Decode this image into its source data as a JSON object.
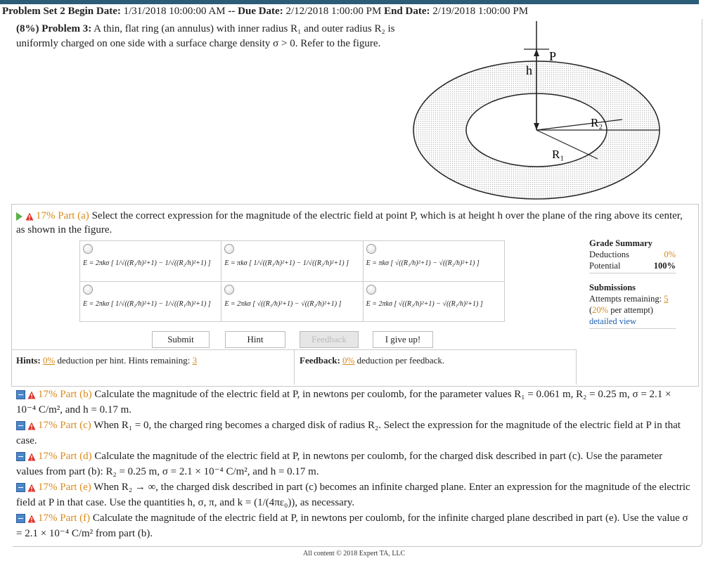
{
  "header": {
    "problem_set": "Problem Set 2",
    "begin_label": "Begin Date:",
    "begin_date": "1/31/2018 10:00:00 AM",
    "sep": "--",
    "due_label": "Due Date:",
    "due_date": "2/12/2018 1:00:00 PM",
    "end_label": "End Date:",
    "end_date": "2/19/2018 1:00:00 PM"
  },
  "problem": {
    "weight": "(8%) Problem 3:",
    "text": "A thin, flat ring (an annulus) with inner radius R₁ and outer radius R₂ is uniformly charged on one side with a surface charge density σ > 0. Refer to the figure."
  },
  "figure": {
    "labels": {
      "p": "P",
      "h": "h",
      "r1": "R₁",
      "r2": "R₂"
    }
  },
  "part_a": {
    "percent": "17% Part (a)",
    "text": "Select the correct expression for the magnitude of the electric field at point P, which is at height h over the plane of the ring above its center, as shown in the figure.",
    "choices": [
      "E = 2πkσ [ 1/√((R₁/h)²+1) − 1/√((R₂/h)²+1) ]",
      "E = πkσ [ 1/√((R₁/h)²+1) − 1/√((R₂/h)²+1) ]",
      "E = πkσ [ √((R₁/h)²+1) − √((R₂/h)²+1) ]",
      "E = 2πkσ [ 1/√((R₂/h)²+1) − 1/√((R₁/h)²+1) ]",
      "E = 2πkσ [ √((R₁/h)²+1) − √((R₂/h)²+1) ]",
      "E = 2πkσ [ √((R₂/h)²+1) − √((R₁/h)²+1) ]"
    ],
    "buttons": {
      "submit": "Submit",
      "hint": "Hint",
      "feedback": "Feedback",
      "give_up": "I give up!"
    },
    "hints": {
      "label": "Hints:",
      "pct": "0%",
      "text": "deduction per hint. Hints remaining:",
      "remaining": "3"
    },
    "feedback": {
      "label": "Feedback:",
      "pct": "0%",
      "text": "deduction per feedback."
    }
  },
  "grade_summary": {
    "title": "Grade Summary",
    "deductions_label": "Deductions",
    "deductions_value": "0%",
    "potential_label": "Potential",
    "potential_value": "100%",
    "submissions_title": "Submissions",
    "attempts_label": "Attempts remaining:",
    "attempts_value": "5",
    "per_attempt_pct": "20%",
    "per_attempt_text": "per attempt)",
    "detailed": "detailed view"
  },
  "parts": [
    {
      "label": "17% Part (b)",
      "text": "Calculate the magnitude of the electric field at P, in newtons per coulomb, for the parameter values R₁ = 0.061 m, R₂ = 0.25 m, σ = 2.1 × 10⁻⁴ C/m², and h = 0.17 m."
    },
    {
      "label": "17% Part (c)",
      "text": "When R₁ = 0, the charged ring becomes a charged disk of radius R₂. Select the expression for the magnitude of the electric field at P in that case."
    },
    {
      "label": "17% Part (d)",
      "text": "Calculate the magnitude of the electric field at P, in newtons per coulomb, for the charged disk described in part (c). Use the parameter values from part (b): R₂ = 0.25 m, σ = 2.1 × 10⁻⁴ C/m², and h = 0.17 m."
    },
    {
      "label": "17% Part (e)",
      "text": "When R₂ → ∞, the charged disk described in part (c) becomes an infinite charged plane. Enter an expression for the magnitude of the electric field at P in that case. Use the quantities h, σ, π, and k = (1/(4πε₀)), as necessary."
    },
    {
      "label": "17% Part (f)",
      "text": "Calculate the magnitude of the electric field at P, in newtons per coulomb, for the infinite charged plane described in part (e). Use the value σ = 2.1 × 10⁻⁴ C/m² from part (b)."
    }
  ],
  "footer": "All content © 2018 Expert TA, LLC"
}
